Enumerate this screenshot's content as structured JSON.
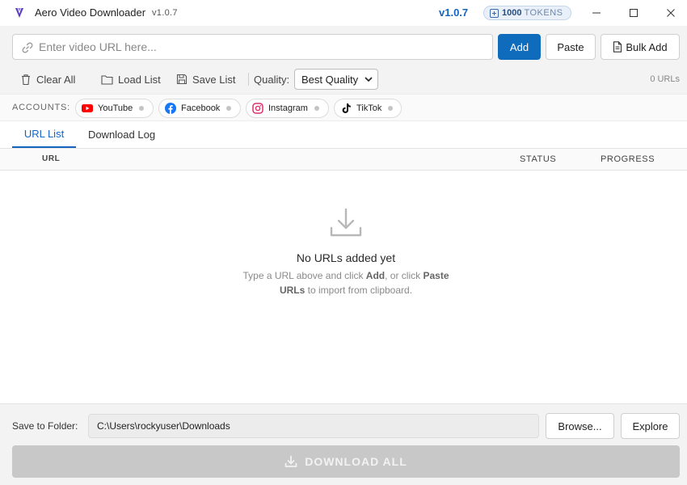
{
  "titlebar": {
    "app_name": "Aero Video Downloader",
    "version_small": "v1.0.7",
    "version_big": "v1.0.7",
    "tokens_count": "1000",
    "tokens_label": "TOKENS"
  },
  "toolbar": {
    "url_placeholder": "Enter video URL here...",
    "add_label": "Add",
    "paste_label": "Paste",
    "bulk_add_label": "Bulk Add",
    "clear_all_label": "Clear All",
    "load_list_label": "Load List",
    "save_list_label": "Save List",
    "quality_label": "Quality:",
    "quality_value": "Best Quality",
    "url_count": "0 URLs"
  },
  "accounts": {
    "label": "ACCOUNTS:",
    "items": [
      {
        "name": "YouTube",
        "icon": "youtube-icon",
        "color": "#ff0000"
      },
      {
        "name": "Facebook",
        "icon": "facebook-icon",
        "color": "#1877f2"
      },
      {
        "name": "Instagram",
        "icon": "instagram-icon",
        "color": "#e1306c"
      },
      {
        "name": "TikTok",
        "icon": "tiktok-icon",
        "color": "#000000"
      }
    ]
  },
  "tabs": [
    {
      "label": "URL List",
      "active": true
    },
    {
      "label": "Download Log",
      "active": false
    }
  ],
  "table": {
    "columns": [
      "URL",
      "STATUS",
      "PROGRESS"
    ]
  },
  "empty_state": {
    "title": "No URLs added yet",
    "line1_prefix": "Type a URL above and click ",
    "line1_bold1": "Add",
    "line1_mid": ", or click ",
    "line1_bold2": "Paste",
    "line2_bold": "URLs",
    "line2_suffix": " to import from clipboard."
  },
  "footer": {
    "save_label": "Save to Folder:",
    "folder_path": "C:\\Users\\rockyuser\\Downloads",
    "browse_label": "Browse...",
    "explore_label": "Explore",
    "download_all_label": "DOWNLOAD ALL"
  },
  "colors": {
    "accent": "#0f6cbd",
    "active_tab": "#1565c0",
    "download_disabled": "#c8c8c8"
  }
}
